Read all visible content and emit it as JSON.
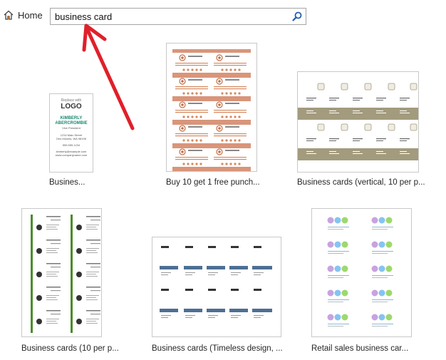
{
  "nav": {
    "home_label": "Home"
  },
  "search": {
    "value": "business card",
    "placeholder": ""
  },
  "templates": [
    {
      "label": "Busines..."
    },
    {
      "label": "Buy 10 get 1 free punch..."
    },
    {
      "label": "Business cards (vertical, 10 per p..."
    },
    {
      "label": "Business cards (10 per p..."
    },
    {
      "label": "Business cards (Timeless design, ..."
    },
    {
      "label": "Retail sales business car..."
    }
  ],
  "thumb1": {
    "replace": "Replace with",
    "logo": "LOGO",
    "name1": "KIMBERLY",
    "name2": "ABERCROMBIE",
    "title": "Vice President",
    "addr1": "1234 Main Street",
    "addr2": "Des Moines, WA 98198",
    "phone": "555.555.1234",
    "email": "kimberly@example.com",
    "web": "www.companyname.com"
  },
  "colors": {
    "accent_green": "#1a8a6e",
    "punch_orange": "#d9957a",
    "taupe": "#a39b7d",
    "retail_green": "#4a8c2a",
    "arrow_red": "#e0202a",
    "slate_blue": "#4d6f94"
  },
  "icons": {
    "home": "home-icon",
    "search": "search-icon"
  }
}
